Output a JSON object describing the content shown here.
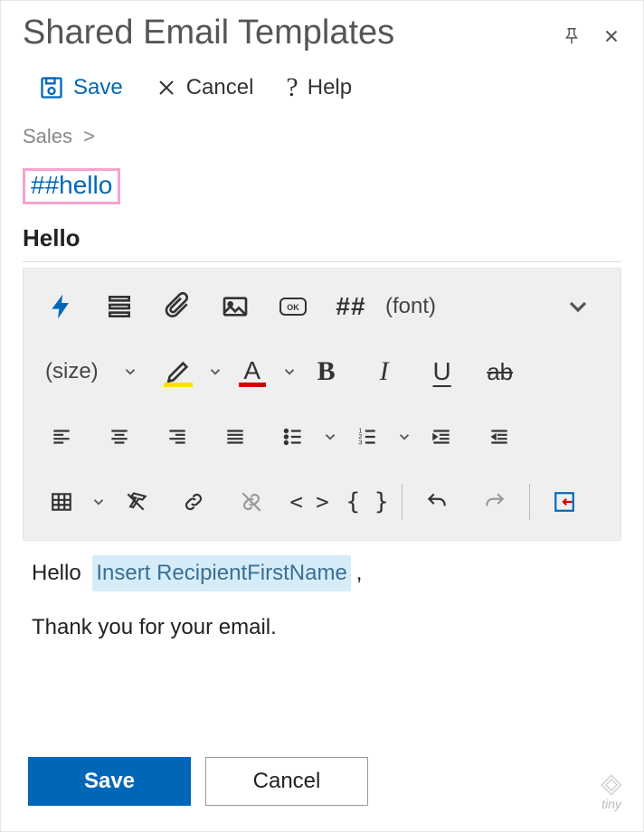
{
  "header": {
    "title": "Shared Email Templates"
  },
  "commands": {
    "save": "Save",
    "cancel": "Cancel",
    "help": "Help"
  },
  "breadcrumb": {
    "root": "Sales",
    "sep": ">"
  },
  "shortcut": "##hello",
  "template_name": "Hello",
  "toolbar": {
    "macro_hash": "##",
    "font_select": "(font)",
    "size_select": "(size)",
    "font_letter": "A",
    "bold": "B",
    "italic": "I",
    "underline": "U",
    "strike": "ab",
    "code_angle": "< >",
    "code_brace": "{ }"
  },
  "body": {
    "greeting_prefix": "Hello",
    "macro": "Insert RecipientFirstName",
    "greeting_suffix": ",",
    "line2": "Thank you for your email."
  },
  "buttons": {
    "save": "Save",
    "cancel": "Cancel"
  },
  "logo": "tiny"
}
